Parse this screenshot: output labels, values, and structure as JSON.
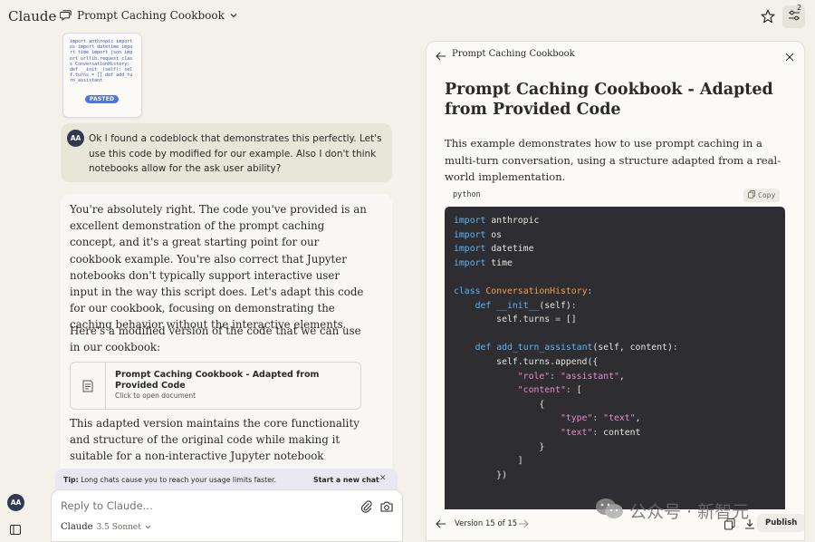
{
  "app": {
    "logo": "Claude"
  },
  "header": {
    "chat_title": "Prompt Caching Cookbook",
    "notification_count": "2"
  },
  "attachment": {
    "preview_text": "import anthropic import os import datetime import time import json import urllib.request class ConversationHistory: def __init__(self): self.turns = [] def add_turn_assistant",
    "badge": "PASTED"
  },
  "user": {
    "initials": "AA",
    "message": "Ok I found a codeblock that demonstrates this perfectly. Let's use this code by modified for our example. Also I don't think notebooks allow for the ask user ability?"
  },
  "assistant": {
    "p1": "You're absolutely right. The code you've provided is an excellent demonstration of the prompt caching concept, and it's a great starting point for our cookbook example. You're also correct that Jupyter notebooks don't typically support interactive user input in the way this script does. Let's adapt this code for our cookbook, focusing on demonstrating the caching behavior without the interactive elements.",
    "p2": "Here's a modified version of the code that we can use in our cookbook:",
    "doc_title": "Prompt Caching Cookbook - Adapted from Provided Code",
    "doc_sub": "Click to open document",
    "p3": "This adapted version maintains the core functionality and structure of the original code while making it suitable for a non-interactive Jupyter notebook environment. It demonstrates the"
  },
  "tip": {
    "label": "Tip:",
    "text": "Long chats cause you to reach your usage limits faster.",
    "link": "Start a new chat",
    "close": "✕"
  },
  "composer": {
    "placeholder": "Reply to Claude...",
    "model": "Claude",
    "model_version": "3.5 Sonnet"
  },
  "artifact": {
    "header_title": "Prompt Caching Cookbook",
    "title": "Prompt Caching Cookbook - Adapted from Provided Code",
    "intro": "This example demonstrates how to use prompt caching in a multi-turn conversation, using a structure adapted from a real-world implementation.",
    "language": "python",
    "copy_label": "Copy",
    "version_label": "Version 15 of 15",
    "publish_label": "Publish"
  },
  "watermark": {
    "text": "公众号 · 新智元"
  },
  "colors": {
    "code_bg": "#2e2d32",
    "keyword": "#5fb3f5",
    "class_name": "#f0a24e",
    "string": "#e88bc9",
    "avatar": "#303951"
  }
}
